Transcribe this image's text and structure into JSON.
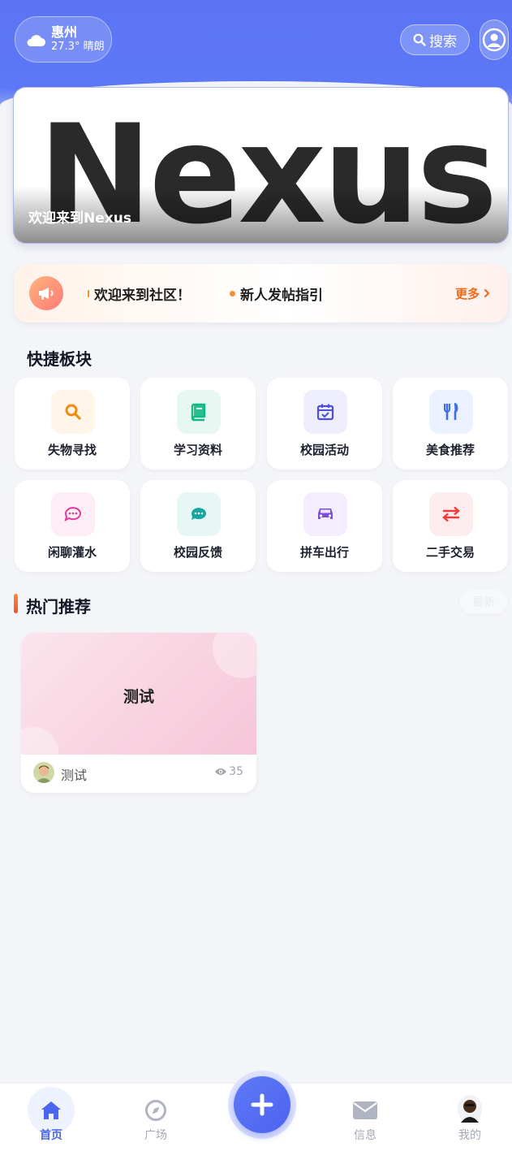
{
  "header": {
    "weather": {
      "city": "惠州",
      "temp": "27.3°",
      "condition": "晴朗",
      "icon": "cloud-icon"
    },
    "search_label": "搜索"
  },
  "banner": {
    "logo_text": "Nexus",
    "caption": "欢迎来到Nexus"
  },
  "notice": {
    "items": [
      "欢迎来到社区！",
      "新人发帖指引"
    ],
    "more_label": "更多"
  },
  "quick": {
    "title": "快捷板块",
    "items": [
      {
        "label": "失物寻找",
        "icon": "search-icon",
        "color": "#f08c12",
        "bg": "#fff5e8"
      },
      {
        "label": "学习资料",
        "icon": "book-icon",
        "color": "#12b886",
        "bg": "#e6f8f1"
      },
      {
        "label": "校园活动",
        "icon": "calendar-icon",
        "color": "#4c4ee0",
        "bg": "#eeeefd"
      },
      {
        "label": "美食推荐",
        "icon": "utensils-icon",
        "color": "#3f6fe8",
        "bg": "#ebf1fe"
      },
      {
        "label": "闲聊灌水",
        "icon": "chat-icon",
        "color": "#e0399a",
        "bg": "#fdeef6"
      },
      {
        "label": "校园反馈",
        "icon": "chat-bubble-icon",
        "color": "#14a6a0",
        "bg": "#e6f7f6"
      },
      {
        "label": "拼车出行",
        "icon": "car-icon",
        "color": "#7e4be0",
        "bg": "#f3edfd"
      },
      {
        "label": "二手交易",
        "icon": "exchange-icon",
        "color": "#ef3b3b",
        "bg": "#fdeced"
      }
    ]
  },
  "hot": {
    "title": "热门推荐",
    "filter_label": "最新",
    "posts": [
      {
        "title": "测试",
        "author": "测试",
        "views": "35"
      }
    ]
  },
  "tabbar": {
    "items": [
      "首页",
      "广场",
      "信息",
      "我的"
    ]
  }
}
